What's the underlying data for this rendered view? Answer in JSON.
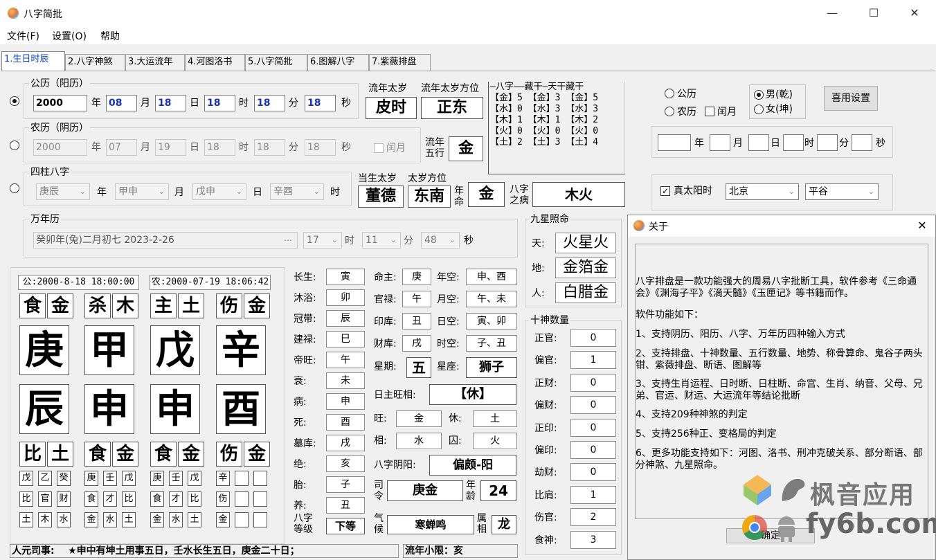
{
  "window": {
    "title": "八字简批",
    "minimize_icon": "minimize-icon",
    "maximize_icon": "maximize-icon",
    "close_icon": "close-icon",
    "close_glyph": "✕",
    "max_glyph": "☐",
    "min_glyph": "—"
  },
  "menu": [
    "文件(F)",
    "设置(O)",
    "帮助"
  ],
  "tabs": [
    "1.生日时辰",
    "2.八字神煞",
    "3.大运流年",
    "4.河图洛书",
    "5.八字简批",
    "6.图解八字",
    "7.紫薇排盘"
  ],
  "solar": {
    "group": "公历（阳历）",
    "year": "2000",
    "month": "08",
    "day": "18",
    "hour": "18",
    "minute": "18",
    "second": "18",
    "u_year": "年",
    "u_month": "月",
    "u_day": "日",
    "u_hour": "时",
    "u_minute": "分",
    "u_second": "秒"
  },
  "lunar": {
    "group": "农历（阴历）",
    "year": "2000",
    "month": "07",
    "day": "19",
    "hour": "18",
    "minute": "18",
    "second": "18",
    "leap": "闰月"
  },
  "sizhu": {
    "group": "四柱八字",
    "year": "庚辰",
    "month": "甲申",
    "day": "戊申",
    "hour": "辛酉",
    "u_year": "年",
    "u_month": "月",
    "u_day": "日",
    "u_hour": "时"
  },
  "wannian": {
    "group": "万年历",
    "value": "癸卯年(兔)二月初七  2023-2-26",
    "ellipsis": "...",
    "hour": "17",
    "minute": "11",
    "second": "48"
  },
  "liunian": {
    "taisui_label": "流年太岁",
    "taisui": "皮时",
    "fangwei_label": "流年太岁方位",
    "fangwei": "正东",
    "wuxing_label1": "流年",
    "wuxing_label2": "五行",
    "wuxing": "金"
  },
  "dangsheng": {
    "taisui_label": "当生太岁",
    "taisui": "董德",
    "fangwei_label": "太岁方位",
    "fangwei": "东南",
    "nianming_label1": "年",
    "nianming_label2": "命",
    "nianming": "金",
    "bing_label1": "八字",
    "bing_label2": "之病",
    "bing": "木火"
  },
  "wuxing_table": {
    "header": "—八字——藏干—天干藏干",
    "rows": [
      "【金】5 【金】3 【金】5",
      "【水】0 【水】3 【水】3",
      "【木】1 【木】1 【木】2",
      "【火】0 【火】0 【火】0",
      "【土】2 【土】3 【土】4"
    ]
  },
  "right_form": {
    "gongli": "公历",
    "nongli": "农历",
    "leap": "闰月",
    "male": "男(乾)",
    "female": "女(坤)",
    "button": "喜用设置",
    "u_year": "年",
    "u_month": "月",
    "u_day": "日",
    "u_hour": "时",
    "u_minute": "分",
    "u_second": "秒",
    "zhentaiyang": "真太阳时",
    "city": "北京",
    "district": "平谷"
  },
  "chart": {
    "gongli_date": "公:2000-8-18 18:00:00",
    "nongli_date": "农:2000-07-19 18:06:42",
    "top": [
      [
        "食",
        "金"
      ],
      [
        "杀",
        "木"
      ],
      [
        "主",
        "土"
      ],
      [
        "伤",
        "金"
      ]
    ],
    "stems": [
      "庚",
      "甲",
      "戊",
      "辛"
    ],
    "branches": [
      "辰",
      "申",
      "申",
      "酉"
    ],
    "bottom": [
      [
        "比",
        "土"
      ],
      [
        "食",
        "金"
      ],
      [
        "食",
        "金"
      ],
      [
        "伤",
        "金"
      ]
    ],
    "hidden_stems": [
      [
        "戊",
        "乙",
        "癸"
      ],
      [
        "庚",
        "壬",
        "戊"
      ],
      [
        "庚",
        "壬",
        "戊"
      ],
      [
        "辛",
        "",
        ""
      ]
    ],
    "hidden_gods": [
      [
        "比",
        "官",
        "财"
      ],
      [
        "食",
        "才",
        "比"
      ],
      [
        "食",
        "才",
        "比"
      ],
      [
        "伤",
        "",
        ""
      ]
    ],
    "hidden_elements": [
      [
        "土",
        "木",
        "水"
      ],
      [
        "金",
        "水",
        "土"
      ],
      [
        "金",
        "水",
        "土"
      ],
      [
        "金",
        "",
        ""
      ]
    ]
  },
  "changsheng": [
    [
      "长生:",
      "寅"
    ],
    [
      "沐浴:",
      "卯"
    ],
    [
      "冠带:",
      "辰"
    ],
    [
      "建禄:",
      "巳"
    ],
    [
      "帝旺:",
      "午"
    ],
    [
      "衰:",
      "未"
    ],
    [
      "病:",
      "申"
    ],
    [
      "死:",
      "酉"
    ],
    [
      "墓库:",
      "戌"
    ],
    [
      "绝:",
      "亥"
    ],
    [
      "胎:",
      "子"
    ],
    [
      "养:",
      "丑"
    ]
  ],
  "grade": {
    "label1": "八字",
    "label2": "等级",
    "value": "下等"
  },
  "mingzhu": [
    [
      "命主:",
      "庚"
    ],
    [
      "官禄:",
      "午"
    ],
    [
      "印库:",
      "丑"
    ],
    [
      "财库:",
      "戌"
    ]
  ],
  "kong": [
    [
      "年空:",
      "申、酉"
    ],
    [
      "月空:",
      "午、未"
    ],
    [
      "日空:",
      "寅、卯"
    ],
    [
      "时空:",
      "子、丑"
    ]
  ],
  "week": {
    "label": "星期:",
    "value": "五",
    "xingzuo_label": "星座:",
    "xingzuo": "狮子"
  },
  "wangxiang": {
    "label": "日主旺相:",
    "value": "【休】",
    "wang_l": "旺:",
    "wang": "金",
    "xiu_l": "休:",
    "xiu": "土",
    "xiang_l": "相:",
    "xiang": "水",
    "qiu_l": "囚:",
    "qiu": "火"
  },
  "yinyang": {
    "label": "八字阴阳:",
    "value": "偏颇-阳"
  },
  "siling": {
    "label1": "司",
    "label2": "令",
    "value": "庚金",
    "age_label1": "年",
    "age_label2": "龄",
    "age": "24"
  },
  "qihou": {
    "label1": "气",
    "label2": "候",
    "value": "寒蝉鸣",
    "shuxiang_label1": "属",
    "shuxiang_label2": "相",
    "shuxiang": "龙"
  },
  "jiuxing": {
    "group": "九星照命",
    "tian_l": "天:",
    "tian": "火星火",
    "di_l": "地:",
    "di": "金箔金",
    "ren_l": "人:",
    "ren": "白腊金"
  },
  "shishen": {
    "group": "十神数量",
    "items": [
      [
        "正官:",
        "0"
      ],
      [
        "偏官:",
        "1"
      ],
      [
        "正财:",
        "0"
      ],
      [
        "偏财:",
        "0"
      ],
      [
        "正印:",
        "0"
      ],
      [
        "偏印:",
        "0"
      ],
      [
        "劫财:",
        "0"
      ],
      [
        "比肩:",
        "1"
      ],
      [
        "伤官:",
        "2"
      ],
      [
        "食神:",
        "3"
      ]
    ]
  },
  "status": {
    "renyuan": "人元司事:    ★申中有坤土用事五日，壬水长生五日，庚金二十日；",
    "xiaoxian": "流年小限：亥"
  },
  "about": {
    "title": "关于",
    "close_glyph": "✕",
    "paras": [
      "        八字排盘是一款功能强大的周易八字批断工具，软件参考《三命通会》《渊海子平》《滴天髓》《玉匣记》等书籍而作。",
      "        软件功能如下：",
      "1、支持阴历、阳历、八字、万年历四种输入方式",
      "2、支持排盘、十神数量、五行数量、地势、称骨算命、鬼谷子两头钳、紫薇排盘、断语、图解等",
      "3、支持生肖运程、日时断、日柱断、命宫、生肖、纳音、父母、兄弟、官运、财运、大运流年等结论批断",
      "4、支持209种神煞的判定",
      "5、支持256种正、变格局的判定",
      "6、更多功能支持如下：河图、洛书、刑冲克破关系、部分断语、部分神煞、九星照命。"
    ],
    "ok": "确定"
  },
  "watermark": {
    "line1": "枫音应用",
    "line2": "fy6b.com"
  },
  "colors": {
    "accent": "#0645c8",
    "input_blue": "#1633b8"
  }
}
